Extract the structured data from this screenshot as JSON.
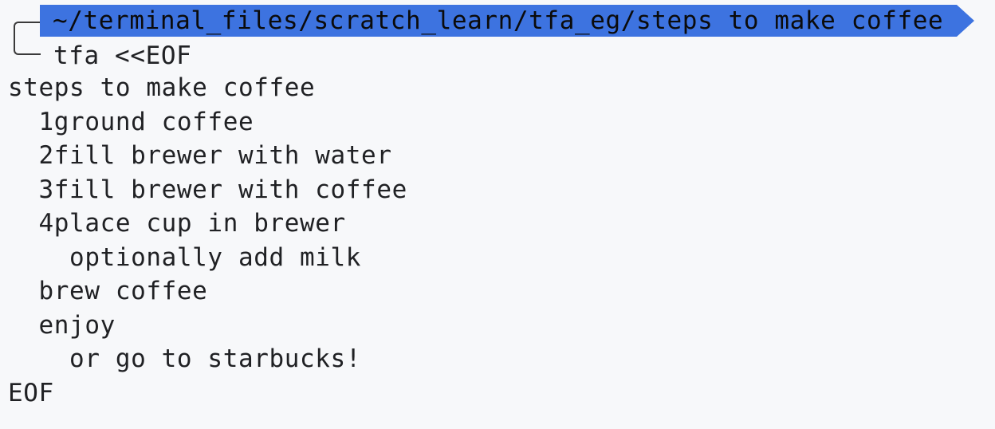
{
  "prompt": {
    "path": "~/terminal_files/scratch_learn/tfa_eg/steps to make coffee",
    "command": "tfa <<EOF"
  },
  "output": {
    "lines": [
      "steps to make coffee",
      "  1ground coffee",
      "  2fill brewer with water",
      "  3fill brewer with coffee",
      "  4place cup in brewer",
      "    optionally add milk",
      "  brew coffee",
      "  enjoy",
      "    or go to starbucks!",
      "EOF"
    ]
  },
  "colors": {
    "path_bar": "#3d73e0",
    "background": "#f7f8fa",
    "text": "#202124"
  }
}
